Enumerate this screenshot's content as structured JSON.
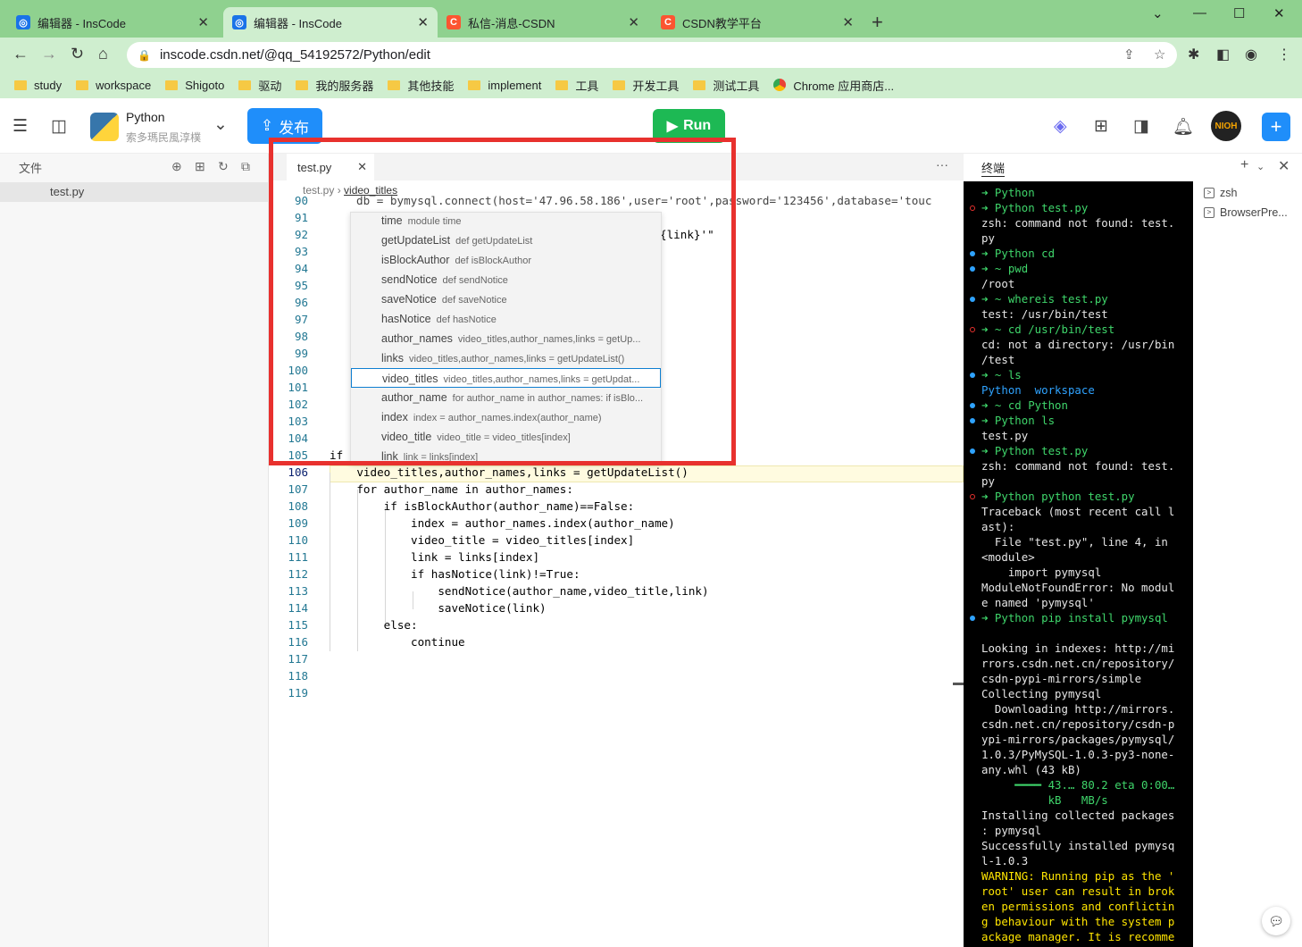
{
  "browser": {
    "tabs": [
      {
        "title": "编辑器 - InsCode",
        "icon": "inscode-icon"
      },
      {
        "title": "编辑器 - InsCode",
        "icon": "inscode-icon"
      },
      {
        "title": "私信-消息-CSDN",
        "icon": "csdn-icon"
      },
      {
        "title": "CSDN教学平台",
        "icon": "csdn-icon"
      }
    ],
    "url": "inscode.csdn.net/@qq_54192572/Python/edit",
    "bookmarks": [
      "study",
      "workspace",
      "Shigoto",
      "驱动",
      "我的服务器",
      "其他技能",
      "implement",
      "工具",
      "开发工具",
      "测试工具",
      "Chrome 应用商店..."
    ],
    "colors": {
      "frame": "#8fd18f",
      "toolbar": "#cfeecf"
    }
  },
  "app": {
    "project_name": "Python",
    "project_owner": "索多瑪民風淳樸",
    "publish_label": "发布",
    "run_label": "Run",
    "accent": "#1f8efa",
    "run_color": "#1db954"
  },
  "sidebar": {
    "title": "文件",
    "files": [
      "test.py"
    ]
  },
  "editor": {
    "tab": "test.py",
    "breadcrumb": {
      "file": "test.py",
      "symbol": "video_titles"
    },
    "line_numbers": [
      "90",
      "91",
      "92",
      "93",
      "94",
      "95",
      "96",
      "97",
      "98",
      "99",
      "100",
      "101",
      "102",
      "103",
      "104",
      "105",
      "106",
      "107",
      "108",
      "109",
      "110",
      "111",
      "112",
      "113",
      "114",
      "115",
      "116",
      "117",
      "118",
      "119"
    ],
    "lines": {
      "l90": "db = bymysql.connect(host='47.96.58.186',user='root',password='123456',database='touc",
      "l92": "{link}'\"",
      "l105": "if",
      "l106": "    video_titles,author_names,links = getUpdateList()",
      "l107": "    for author_name in author_names:",
      "l108": "        if isBlockAuthor(author_name)==False:",
      "l109": "            index = author_names.index(author_name)",
      "l110": "            video_title = video_titles[index]",
      "l111": "            link = links[index]",
      "l112": "            if hasNotice(link)!=True:",
      "l113": "                sendNotice(author_name,video_title,link)",
      "l114": "                saveNotice(link)",
      "l115": "        else:",
      "l116": "            continue"
    },
    "suggestions": [
      {
        "name": "time",
        "detail": "module time"
      },
      {
        "name": "getUpdateList",
        "detail": "def getUpdateList"
      },
      {
        "name": "isBlockAuthor",
        "detail": "def isBlockAuthor"
      },
      {
        "name": "sendNotice",
        "detail": "def sendNotice"
      },
      {
        "name": "saveNotice",
        "detail": "def saveNotice"
      },
      {
        "name": "hasNotice",
        "detail": "def hasNotice"
      },
      {
        "name": "author_names",
        "detail": "video_titles,author_names,links = getUp..."
      },
      {
        "name": "links",
        "detail": "video_titles,author_names,links = getUpdateList()"
      },
      {
        "name": "video_titles",
        "detail": "video_titles,author_names,links = getUpdat..."
      },
      {
        "name": "author_name",
        "detail": "for author_name in author_names: if isBlo..."
      },
      {
        "name": "index",
        "detail": "index = author_names.index(author_name)"
      },
      {
        "name": "video_title",
        "detail": "video_title = video_titles[index]"
      },
      {
        "name": "link",
        "detail": "link = links[index]"
      }
    ]
  },
  "terminal": {
    "tab_label": "终端",
    "sessions": [
      "zsh",
      "BrowserPre..."
    ],
    "lines": [
      "➜ Python",
      "➜ Python test.py",
      "zsh: command not found: test.",
      "py",
      "➜ Python cd",
      "➜ ~ pwd",
      "/root",
      "➜ ~ whereis test.py",
      "test: /usr/bin/test",
      "➜ ~ cd /usr/bin/test",
      "cd: not a directory: /usr/bin",
      "/test",
      "➜ ~ ls",
      "Python  workspace",
      "➜ ~ cd Python",
      "➜ Python ls",
      "test.py",
      "➜ Python test.py",
      "zsh: command not found: test.",
      "py",
      "➜ Python python test.py",
      "Traceback (most recent call l",
      "ast):",
      "  File \"test.py\", line 4, in",
      "<module>",
      "    import pymysql",
      "ModuleNotFoundError: No modul",
      "e named 'pymysql'",
      "➜ Python pip install pymysql",
      "",
      "Looking in indexes: http://mi",
      "rrors.csdn.net.cn/repository/",
      "csdn-pypi-mirrors/simple",
      "Collecting pymysql",
      "  Downloading http://mirrors.",
      "csdn.net.cn/repository/csdn-p",
      "ypi-mirrors/packages/pymysql/",
      "1.0.3/PyMySQL-1.0.3-py3-none-",
      "any.whl (43 kB)",
      "     ━━━━ 43.… 80.2 eta 0:00…",
      "          kB   MB/s",
      "Installing collected packages",
      ": pymysql",
      "Successfully installed pymysq",
      "l-1.0.3",
      "WARNING: Running pip as the '",
      "root' user can result in brok",
      "en permissions and conflictin",
      "g behaviour with the system p",
      "ackage manager. It is recomme"
    ]
  }
}
